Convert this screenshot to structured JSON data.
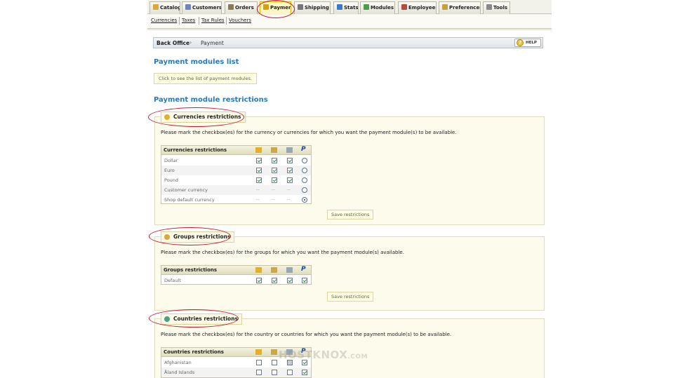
{
  "tabs": [
    {
      "label": "Catalog",
      "icon": "folder-icon",
      "color": "#d9a93a"
    },
    {
      "label": "Customers",
      "icon": "user-icon",
      "color": "#6b87b8"
    },
    {
      "label": "Orders",
      "icon": "cart-icon",
      "color": "#8a7a5a"
    },
    {
      "label": "Payment",
      "icon": "money-icon",
      "color": "#d4a017"
    },
    {
      "label": "Shipping",
      "icon": "truck-icon",
      "color": "#777777"
    },
    {
      "label": "Stats",
      "icon": "chart-icon",
      "color": "#3a7ac8"
    },
    {
      "label": "Modules",
      "icon": "puzzle-icon",
      "color": "#4aa04a"
    },
    {
      "label": "Employees",
      "icon": "employee-icon",
      "color": "#b84a3a"
    },
    {
      "label": "Preferences",
      "icon": "preferences-icon",
      "color": "#c8a040"
    },
    {
      "label": "Tools",
      "icon": "wrench-icon",
      "color": "#888888"
    }
  ],
  "active_tab": "Payment",
  "subnav": [
    "Currencies",
    "Taxes",
    "Tax Rules",
    "Vouchers"
  ],
  "breadcrumb": {
    "root": "Back Office",
    "arrow": "›",
    "current": "Payment"
  },
  "help": {
    "label": "HELP"
  },
  "modules_list": {
    "title": "Payment modules list",
    "button": "Click to see the list of payment modules."
  },
  "restrictions_title": "Payment module restrictions",
  "module_icons": [
    "thumb-icon",
    "cheque-icon",
    "wire-icon",
    "paypal-icon"
  ],
  "currencies": {
    "legend": "Currencies restrictions",
    "description": "Please mark the checkbox(es) for the currency or currencies for which you want the payment module(s) to be available.",
    "table_title": "Currencies restrictions",
    "rows": [
      {
        "label": "Dollar",
        "cells": [
          "check",
          "check",
          "check",
          "radio"
        ]
      },
      {
        "label": "Euro",
        "cells": [
          "check",
          "check",
          "check",
          "radio"
        ]
      },
      {
        "label": "Pound",
        "cells": [
          "check",
          "check",
          "check",
          "radio"
        ]
      },
      {
        "label": "Customer currency",
        "cells": [
          "--",
          "--",
          "--",
          "radio"
        ]
      },
      {
        "label": "Shop default currency",
        "cells": [
          "--",
          "--",
          "--",
          "radio-on"
        ]
      }
    ],
    "save": "Save restrictions"
  },
  "groups": {
    "legend": "Groups restrictions",
    "description": "Please mark the checkbox(es) for the groups for which you want the payment module(s) available.",
    "table_title": "Groups restrictions",
    "rows": [
      {
        "label": "Default",
        "cells": [
          "check",
          "check",
          "check",
          "check"
        ]
      }
    ],
    "save": "Save restrictions"
  },
  "countries": {
    "legend": "Countries restrictions",
    "description": "Please mark the checkbox(es) for the country or countries for which you want the payment module(s) to be available.",
    "table_title": "Countries restrictions",
    "rows": [
      {
        "label": "Afghanistan",
        "cells": [
          "empty",
          "empty",
          "gray",
          "check"
        ]
      },
      {
        "label": "Åland Islands",
        "cells": [
          "empty",
          "empty",
          "empty",
          "check"
        ]
      }
    ]
  },
  "watermark": {
    "main": "HOSTKNOX",
    "suffix": ".COM"
  }
}
